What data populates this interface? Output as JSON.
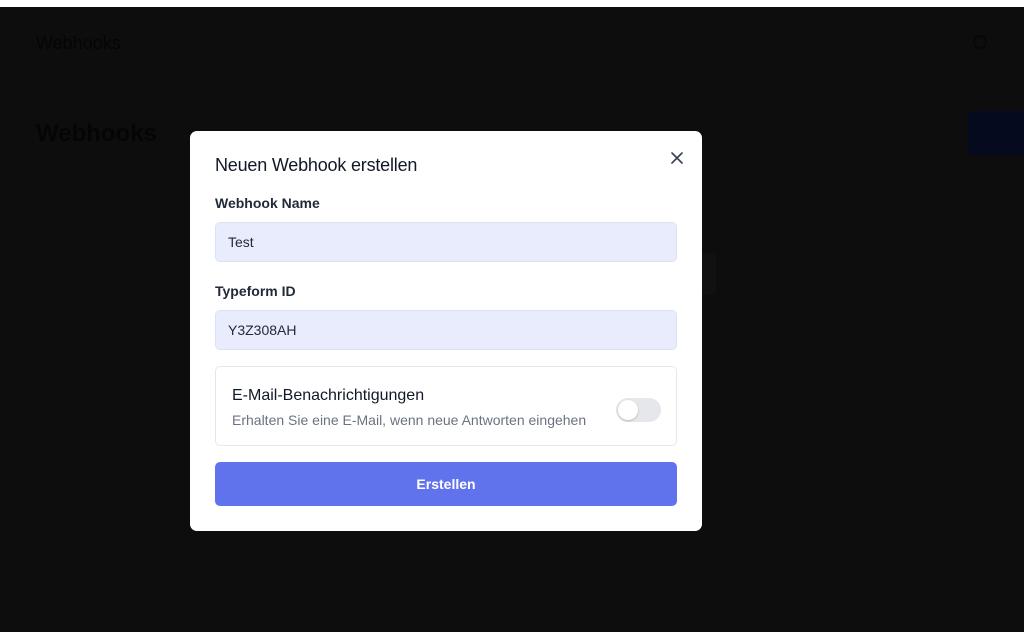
{
  "app": {
    "header_title": "Webhooks",
    "page_title": "Webhooks"
  },
  "modal": {
    "title": "Neuen Webhook erstellen",
    "close_icon": "close-icon",
    "webhook_name": {
      "label": "Webhook Name",
      "value": "Test"
    },
    "typeform_id": {
      "label": "Typeform ID",
      "value": "Y3Z308AH"
    },
    "email_notifications": {
      "title": "E-Mail-Benachrichtigungen",
      "description": "Erhalten Sie eine E-Mail, wenn neue Antworten eingehen",
      "enabled": false
    },
    "submit_label": "Erstellen"
  },
  "colors": {
    "overlay": "#0c0c0c",
    "primary": "#6172ed",
    "input_bg": "#e8ecfc",
    "toggle_off": "#e5e7eb"
  }
}
